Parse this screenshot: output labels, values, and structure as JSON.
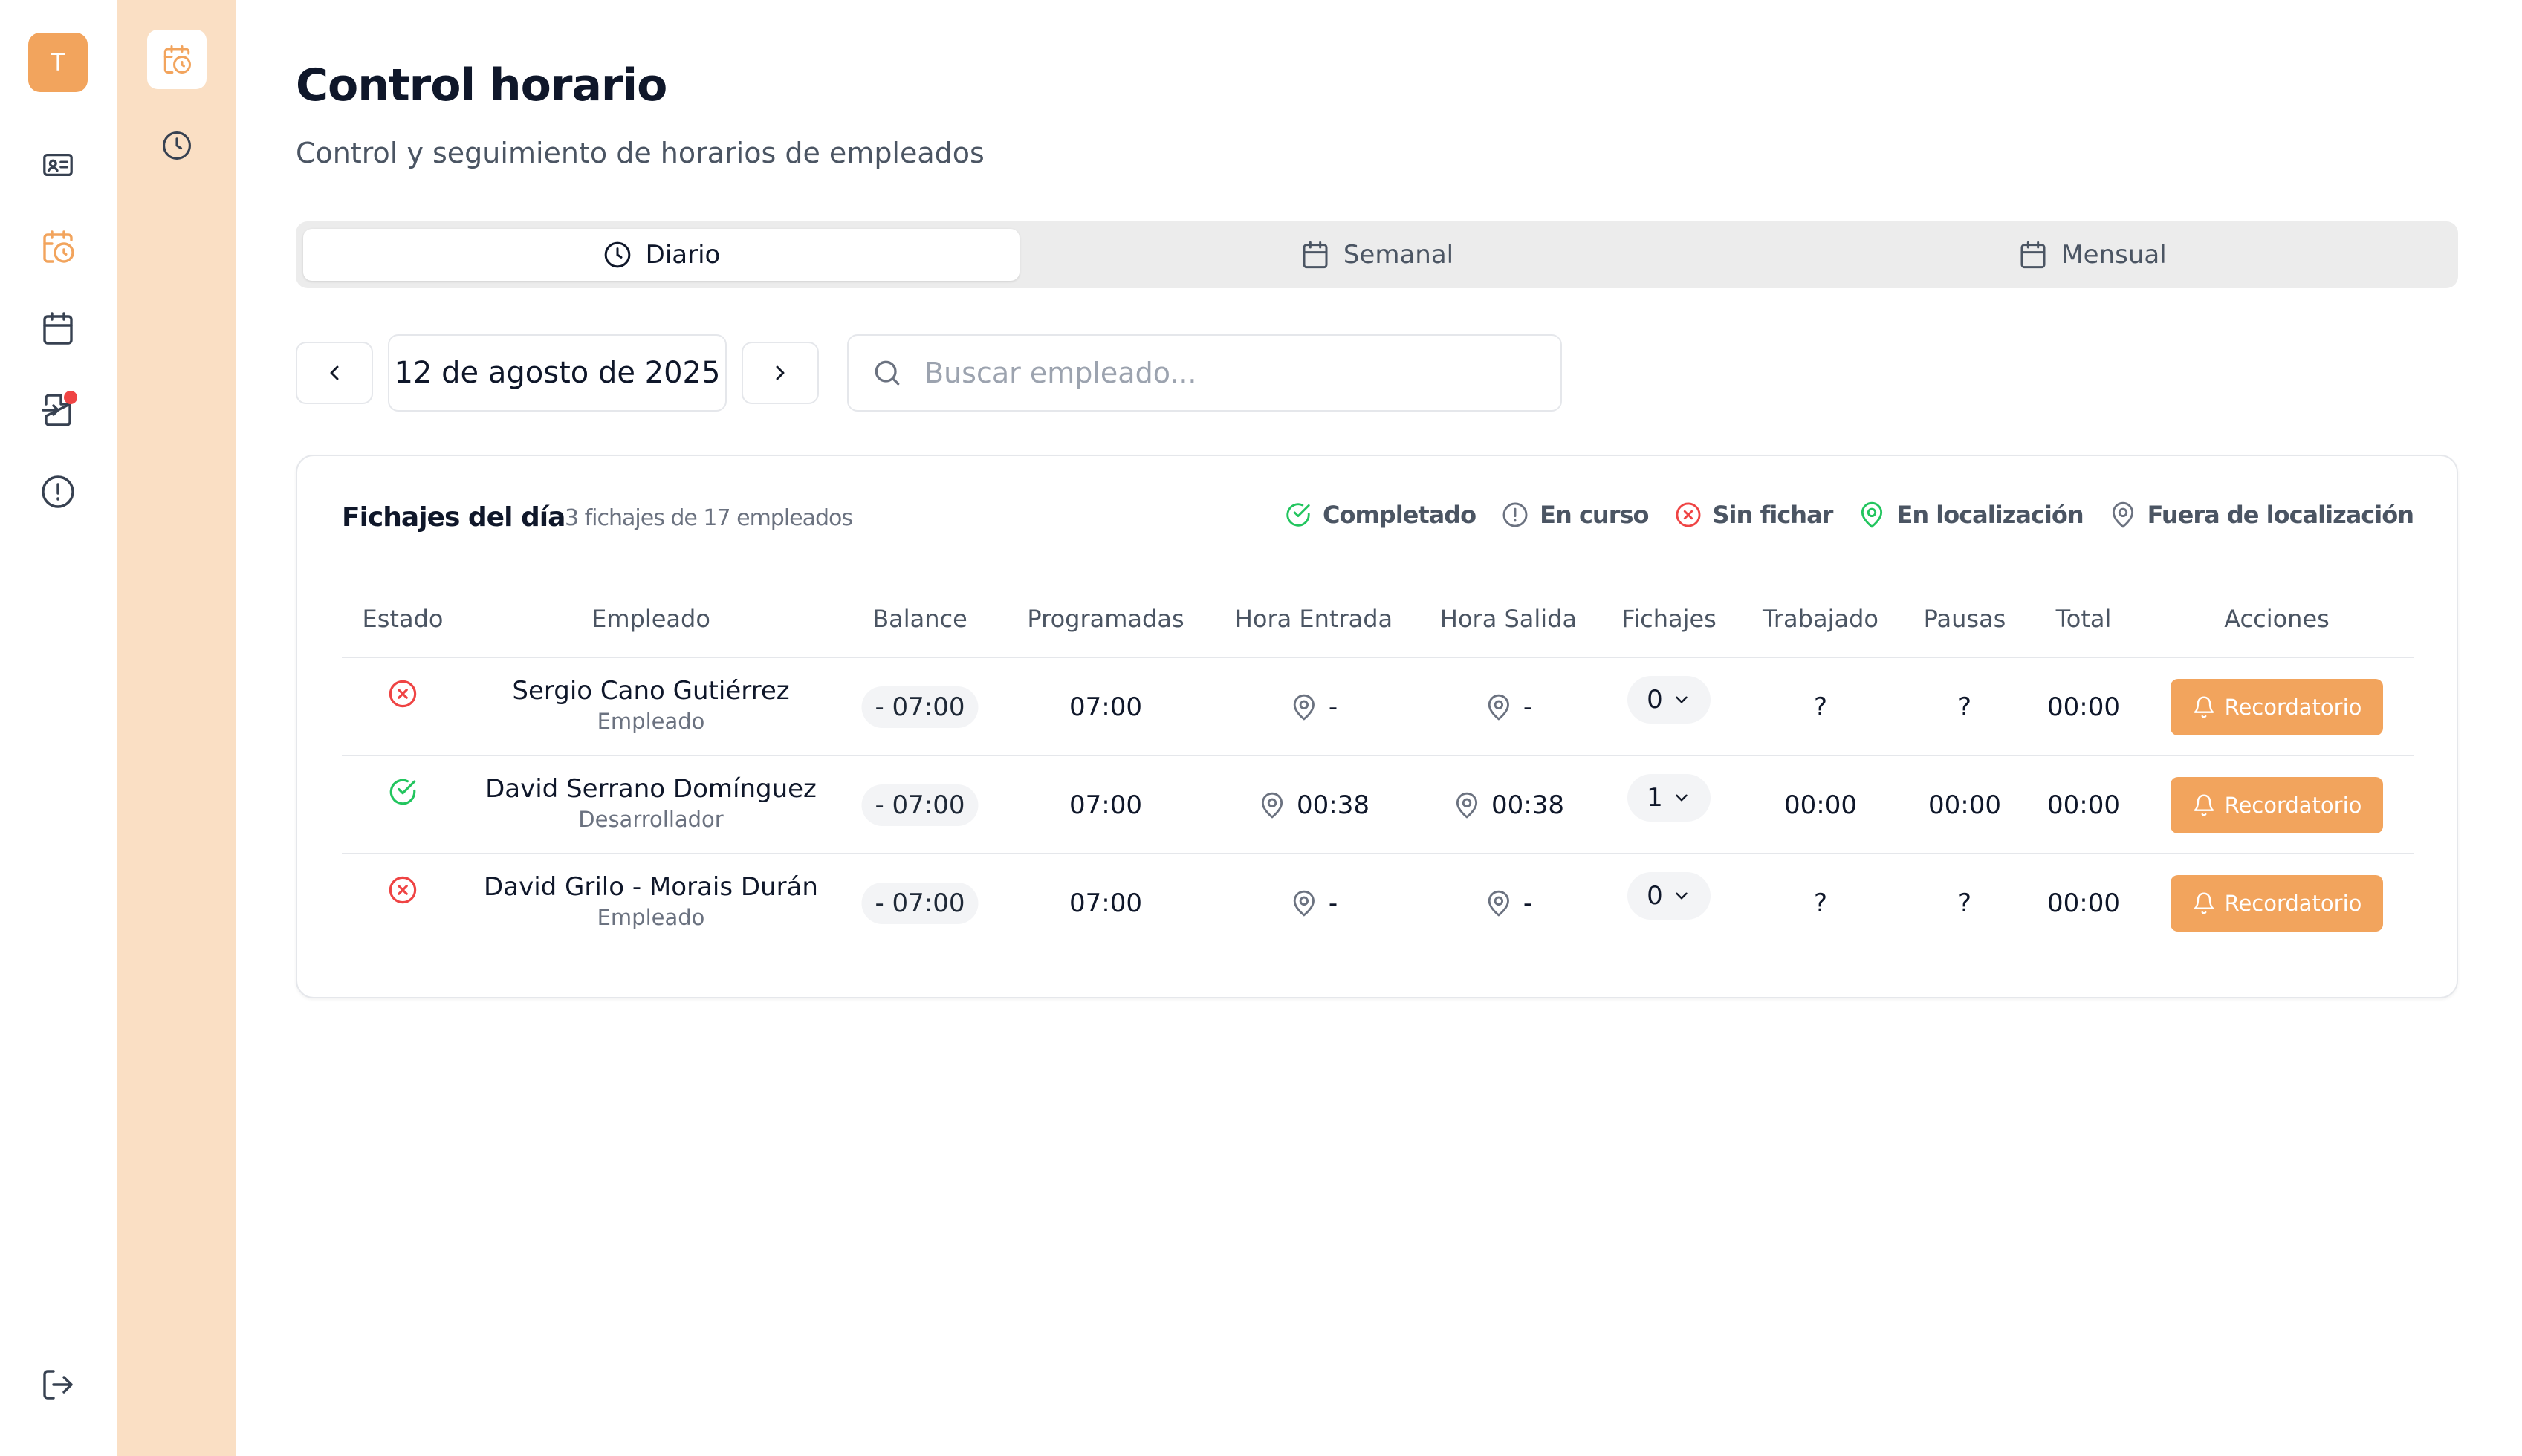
{
  "sidebar": {
    "avatar_letter": "T",
    "icons": [
      "id-card-icon",
      "calendar-clock-icon",
      "calendar-icon",
      "sign-in-icon",
      "alert-icon"
    ],
    "logout_icon": "logout-icon",
    "active_color": "#f2a45d",
    "badge_color": "#ef4444"
  },
  "subrail": {
    "icons": [
      "calendar-clock-icon",
      "clock-icon"
    ],
    "background": "#fadfc4"
  },
  "header": {
    "title": "Control horario",
    "subtitle": "Control y seguimiento de horarios de empleados"
  },
  "tabs": [
    {
      "label": "Diario",
      "icon": "clock-icon",
      "active": true
    },
    {
      "label": "Semanal",
      "icon": "calendar-icon",
      "active": false
    },
    {
      "label": "Mensual",
      "icon": "calendar-icon",
      "active": false
    }
  ],
  "date_nav": {
    "date": "12 de agosto de 2025"
  },
  "search": {
    "placeholder": "Buscar empleado..."
  },
  "card": {
    "title": "Fichajes del día",
    "summary": "3 fichajes de 17 empleados",
    "legend": [
      {
        "label": "Completado",
        "icon": "check-circle-icon",
        "color": "#22c55e"
      },
      {
        "label": "En curso",
        "icon": "alert-circle-icon",
        "color": "#6b7280"
      },
      {
        "label": "Sin fichar",
        "icon": "x-circle-icon",
        "color": "#ef4444"
      },
      {
        "label": "En localización",
        "icon": "map-pin-icon",
        "color": "#22c55e"
      },
      {
        "label": "Fuera de localización",
        "icon": "map-pin-icon",
        "color": "#6b7280"
      }
    ]
  },
  "table": {
    "headers": [
      "Estado",
      "Empleado",
      "Balance",
      "Programadas",
      "Hora Entrada",
      "Hora Salida",
      "Fichajes",
      "Trabajado",
      "Pausas",
      "Total",
      "Acciones"
    ],
    "rows": [
      {
        "status": "sin-fichar",
        "name": "Sergio Cano Gutiérrez",
        "role": "Empleado",
        "balance": "- 07:00",
        "scheduled": "07:00",
        "entry": "-",
        "exit": "-",
        "fichajes": "0",
        "worked": "?",
        "breaks": "?",
        "total": "00:00",
        "action": "Recordatorio"
      },
      {
        "status": "completado",
        "name": "David Serrano Domínguez",
        "role": "Desarrollador",
        "balance": "- 07:00",
        "scheduled": "07:00",
        "entry": "00:38",
        "exit": "00:38",
        "fichajes": "1",
        "worked": "00:00",
        "breaks": "00:00",
        "total": "00:00",
        "action": "Recordatorio"
      },
      {
        "status": "sin-fichar",
        "name": "David Grilo - Morais Durán",
        "role": "Empleado",
        "balance": "- 07:00",
        "scheduled": "07:00",
        "entry": "-",
        "exit": "-",
        "fichajes": "0",
        "worked": "?",
        "breaks": "?",
        "total": "00:00",
        "action": "Recordatorio"
      }
    ]
  }
}
